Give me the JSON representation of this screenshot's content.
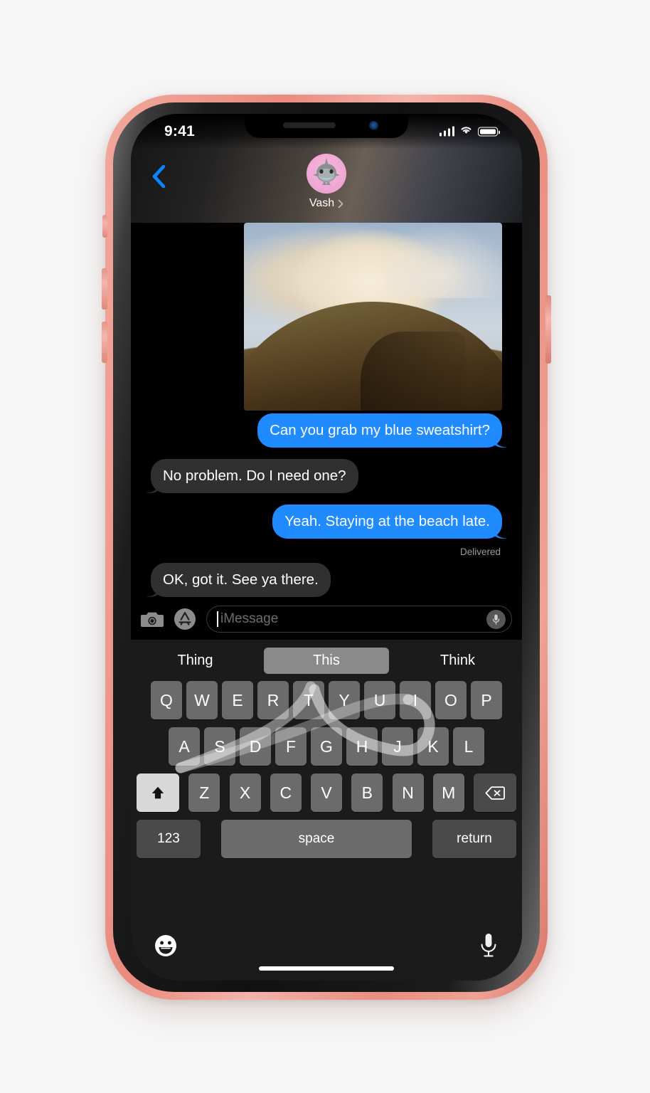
{
  "device": {
    "model_color": "#ef9d90",
    "buttons": [
      "mute-switch",
      "volume-up",
      "volume-down",
      "power"
    ]
  },
  "status_bar": {
    "time": "9:41",
    "cellular_icon": "signal-bars-icon",
    "wifi_icon": "wifi-icon",
    "battery_icon": "battery-icon"
  },
  "nav_bar": {
    "back_icon": "back-chevron-icon",
    "contact_name": "Vash",
    "contact_chevron_icon": "chevron-right-icon",
    "avatar_icon": "shark-memoji-avatar",
    "avatar_bg": "#efa8d4"
  },
  "conversation": {
    "attachment": {
      "type": "photo",
      "description": "hill-photo-attachment"
    },
    "messages": [
      {
        "id": "b1",
        "text": "Can you grab my blue sweatshirt?",
        "side": "sent"
      },
      {
        "id": "b2",
        "text": "No problem. Do I need one?",
        "side": "received"
      },
      {
        "id": "b3",
        "text": "Yeah. Staying at the beach late.",
        "side": "sent"
      },
      {
        "id": "b4",
        "text": "OK, got it. See ya there.",
        "side": "received"
      }
    ],
    "delivery_status": "Delivered",
    "sent_bubble_color": "#1f8bff",
    "received_bubble_color": "#303030"
  },
  "input_bar": {
    "camera_icon": "camera-icon",
    "appstore_icon": "app-store-icon",
    "placeholder": "iMessage",
    "value": "",
    "dictate_icon": "microphone-icon"
  },
  "keyboard": {
    "predictions": [
      {
        "label": "Thing",
        "selected": false
      },
      {
        "label": "This",
        "selected": true
      },
      {
        "label": "Think",
        "selected": false
      }
    ],
    "row1": [
      "Q",
      "W",
      "E",
      "R",
      "T",
      "Y",
      "U",
      "I",
      "O",
      "P"
    ],
    "row2": [
      "A",
      "S",
      "D",
      "F",
      "G",
      "H",
      "J",
      "K",
      "L"
    ],
    "row3": [
      "Z",
      "X",
      "C",
      "V",
      "B",
      "N",
      "M"
    ],
    "shift_icon": "shift-up-arrow-icon",
    "backspace_icon": "backspace-delete-icon",
    "numbers_label": "123",
    "space_label": "space",
    "return_label": "return",
    "swipe_trail": "quickpath-swipe-trail"
  },
  "bottom_bar": {
    "emoji_icon": "emoji-smiley-icon",
    "dictation_icon": "microphone-icon",
    "home_indicator": "home-indicator-bar"
  }
}
